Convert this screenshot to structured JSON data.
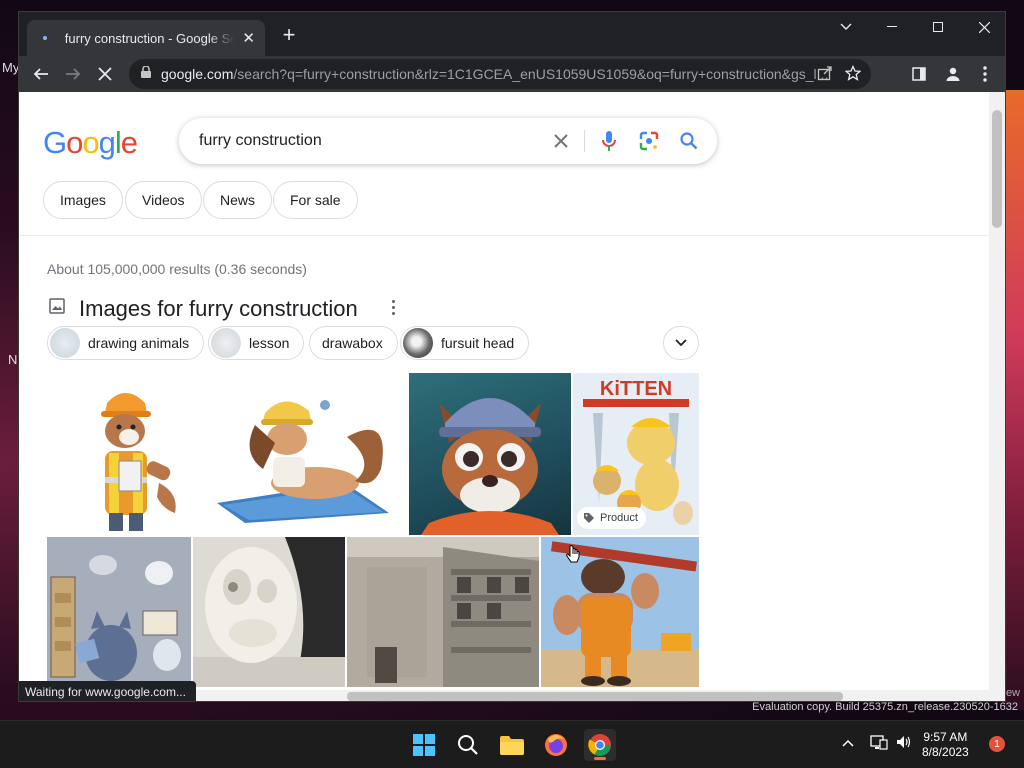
{
  "desktop": {
    "left_glyphs": [
      "My",
      "N"
    ],
    "watermark": "Evaluation copy. Build 25375.zn_release.230520-1632",
    "watermark_fragment": "ew"
  },
  "browser": {
    "tab": {
      "title": "furry construction - Google Search"
    },
    "address": {
      "domain": "google.com",
      "path": "/search?q=furry+construction&rlz=1C1GCEA_enUS1059US1059&oq=furry+construction&gs_l..."
    },
    "status_text": "Waiting for www.google.com..."
  },
  "google": {
    "logo_letters": [
      {
        "ch": "G",
        "color": "#4285F4"
      },
      {
        "ch": "o",
        "color": "#EA4335"
      },
      {
        "ch": "o",
        "color": "#FBBC05"
      },
      {
        "ch": "g",
        "color": "#4285F4"
      },
      {
        "ch": "l",
        "color": "#34A853"
      },
      {
        "ch": "e",
        "color": "#EA4335"
      }
    ],
    "search_query": "furry construction",
    "filter_chips": [
      "Images",
      "Videos",
      "News",
      "For sale"
    ],
    "result_stats": "About 105,000,000 results (0.36 seconds)",
    "images_heading": "Images for furry construction",
    "refinements": [
      "drawing animals",
      "lesson",
      "drawabox",
      "fursuit head"
    ],
    "product_badge": "Product"
  },
  "taskbar": {
    "time": "9:57 AM",
    "date": "8/8/2023",
    "notification_count": "1"
  },
  "colors": {
    "google_blue": "#4285F4",
    "google_red": "#EA4335",
    "google_yellow": "#FBBC05",
    "google_green": "#34A853",
    "chrome_dark": "#202124"
  }
}
